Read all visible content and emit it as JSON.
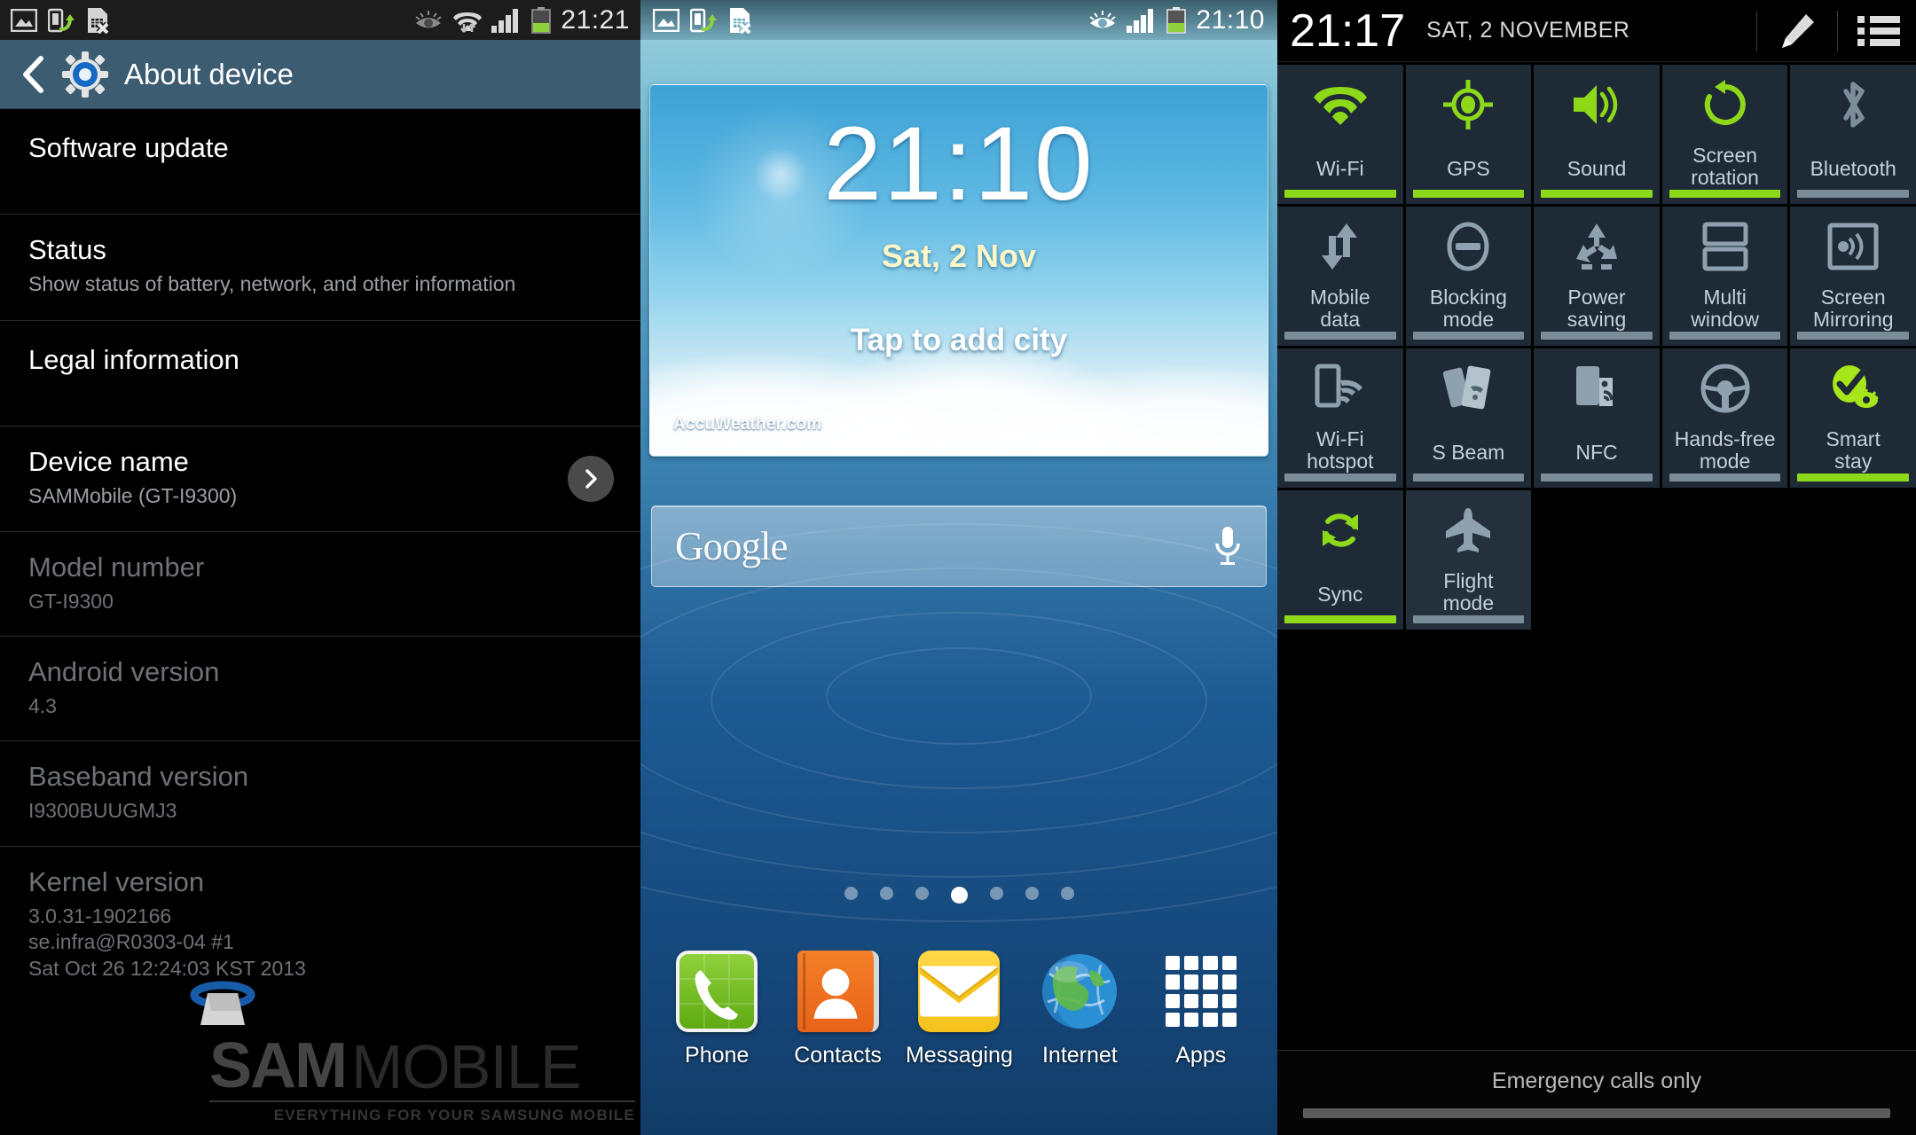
{
  "panel_settings": {
    "statusbar": {
      "icons": [
        "image-icon",
        "screen-share-icon",
        "sim-card-error-icon",
        "smart-stay-eye-icon",
        "wifi-transfer-icon",
        "signal-bars-icon",
        "battery-icon"
      ],
      "clock": "21:21"
    },
    "actionbar": {
      "back_icon": "back-chevron-icon",
      "app_icon": "settings-gear-icon",
      "title": "About device"
    },
    "items": [
      {
        "title": "Software update",
        "sub": "",
        "dim": false,
        "chevron": false
      },
      {
        "title": "Status",
        "sub": "Show status of battery, network, and other information",
        "dim": false,
        "chevron": false
      },
      {
        "title": "Legal information",
        "sub": "",
        "dim": false,
        "chevron": false
      },
      {
        "title": "Device name",
        "sub": "SAMMobile (GT-I9300)",
        "dim": false,
        "chevron": true
      },
      {
        "title": "Model number",
        "sub": "GT-I9300",
        "dim": true,
        "chevron": false
      },
      {
        "title": "Android version",
        "sub": "4.3",
        "dim": true,
        "chevron": false
      },
      {
        "title": "Baseband version",
        "sub": "I9300BUUGMJ3",
        "dim": true,
        "chevron": false
      },
      {
        "title": "Kernel version",
        "sub": "3.0.31-1902166\nse.infra@R0303-04 #1\nSat Oct 26 12:24:03 KST 2013",
        "dim": true,
        "chevron": false
      }
    ],
    "watermark": {
      "brand_bold": "SAM",
      "brand_light": "MOBILE",
      "tagline": "EVERYTHING FOR YOUR SAMSUNG MOBILE"
    }
  },
  "panel_home": {
    "statusbar": {
      "icons": [
        "image-icon",
        "screen-share-icon",
        "sim-card-error-icon",
        "smart-stay-eye-icon",
        "signal-bars-icon",
        "battery-icon"
      ],
      "clock": "21:10"
    },
    "weather_widget": {
      "time": "21:10",
      "date": "Sat, 2 Nov",
      "tap_hint": "Tap to add city",
      "provider": "AccuWeather.com"
    },
    "search": {
      "logo_text": "Google",
      "mic_icon": "microphone-icon"
    },
    "page_dots": {
      "count": 7,
      "active_index": 3
    },
    "dock": [
      {
        "label": "Phone",
        "icon": "phone-icon"
      },
      {
        "label": "Contacts",
        "icon": "contacts-book-icon"
      },
      {
        "label": "Messaging",
        "icon": "envelope-icon"
      },
      {
        "label": "Internet",
        "icon": "globe-icon"
      },
      {
        "label": "Apps",
        "icon": "app-grid-icon"
      }
    ]
  },
  "panel_notifications": {
    "header": {
      "time": "21:17",
      "date": "SAT, 2 NOVEMBER",
      "edit_icon": "pencil-icon",
      "list_icon": "list-menu-icon"
    },
    "toggles": [
      {
        "label": "Wi-Fi",
        "icon": "wifi-icon",
        "on": true
      },
      {
        "label": "GPS",
        "icon": "gps-crosshair-icon",
        "on": true
      },
      {
        "label": "Sound",
        "icon": "speaker-icon",
        "on": true
      },
      {
        "label": "Screen\nrotation",
        "icon": "rotate-ccw-icon",
        "on": true
      },
      {
        "label": "Bluetooth",
        "icon": "bluetooth-icon",
        "on": false
      },
      {
        "label": "Mobile\ndata",
        "icon": "data-arrows-icon",
        "on": false
      },
      {
        "label": "Blocking\nmode",
        "icon": "minus-circle-icon",
        "on": false
      },
      {
        "label": "Power\nsaving",
        "icon": "recycle-icon",
        "on": false
      },
      {
        "label": "Multi\nwindow",
        "icon": "split-window-icon",
        "on": false
      },
      {
        "label": "Screen\nMirroring",
        "icon": "screen-cast-icon",
        "on": false
      },
      {
        "label": "Wi-Fi\nhotspot",
        "icon": "hotspot-icon",
        "on": false
      },
      {
        "label": "S Beam",
        "icon": "s-beam-icon",
        "on": false
      },
      {
        "label": "NFC",
        "icon": "nfc-tag-icon",
        "on": false
      },
      {
        "label": "Hands-free\nmode",
        "icon": "steering-wheel-icon",
        "on": false
      },
      {
        "label": "Smart\nstay",
        "icon": "smart-stay-icon",
        "on": true
      },
      {
        "label": "Sync",
        "icon": "sync-icon",
        "on": true
      },
      {
        "label": "Flight\nmode",
        "icon": "airplane-icon",
        "on": false
      }
    ],
    "footer": {
      "status_text": "Emergency calls only"
    }
  },
  "colors": {
    "accent_green": "#8ed81a",
    "tile_bg": "#1e2a36",
    "actionbar_blue": "#3c5c72",
    "tile_label": "#c6d0d8",
    "tile_off_bar": "#7b8c99"
  }
}
